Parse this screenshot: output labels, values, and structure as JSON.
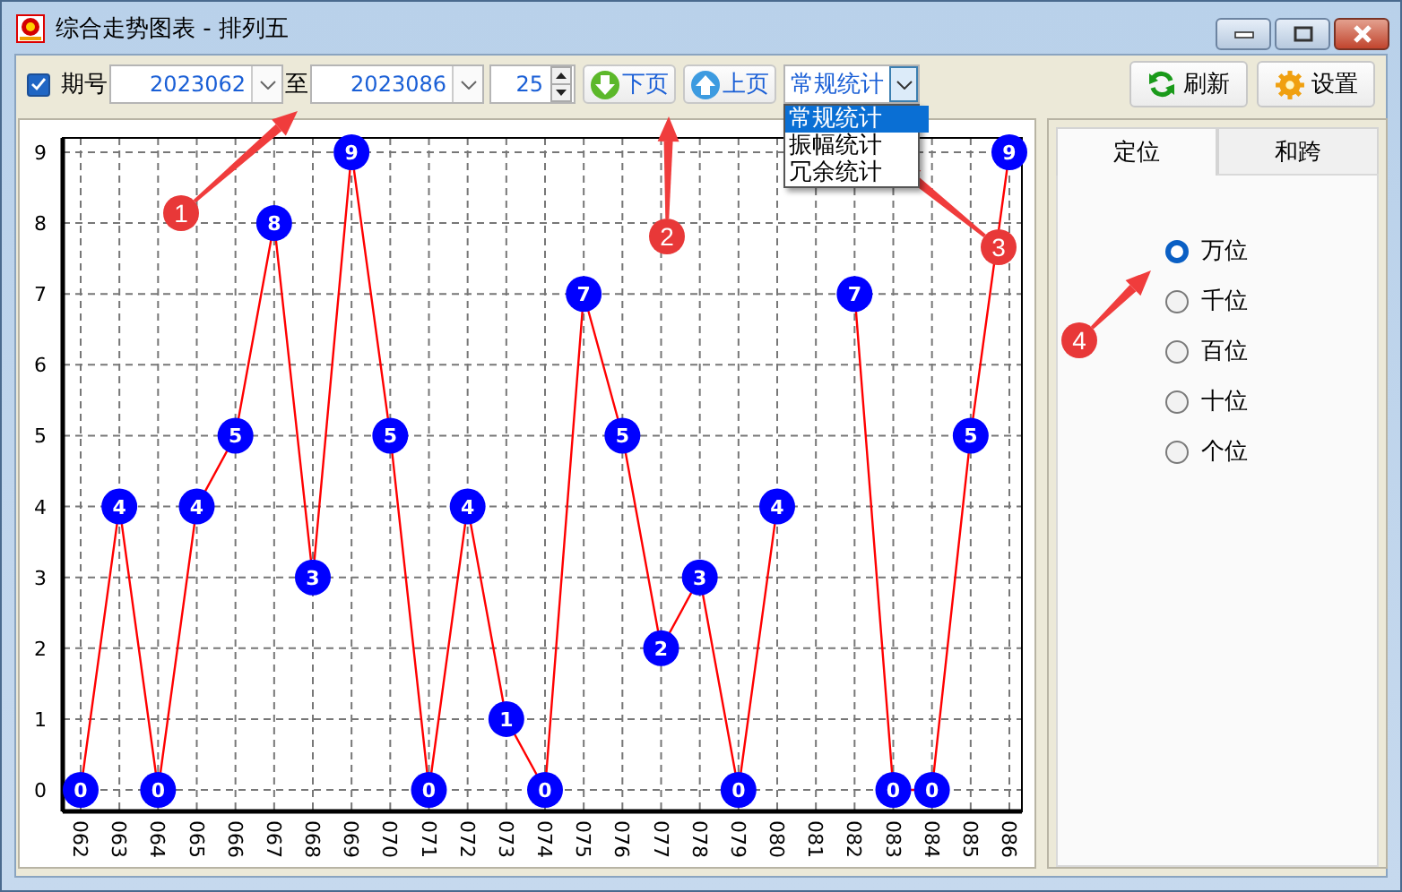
{
  "window": {
    "title": "综合走势图表 - 排列五"
  },
  "toolbar": {
    "period_checkbox": {
      "label": "期号",
      "checked": true
    },
    "from_issue": "2023062",
    "to_label": "至",
    "to_issue": "2023086",
    "count": "25",
    "next_page": "下页",
    "prev_page": "上页",
    "stat_select": {
      "value": "常规统计",
      "open": true,
      "options": [
        {
          "label": "常规统计",
          "selected": true
        },
        {
          "label": "振幅统计",
          "selected": false
        },
        {
          "label": "冗余统计",
          "selected": false
        }
      ]
    },
    "refresh": "刷新",
    "settings": "设置"
  },
  "chart": {
    "chart_data": {
      "type": "line",
      "categories": [
        "062",
        "063",
        "064",
        "065",
        "066",
        "067",
        "068",
        "069",
        "070",
        "071",
        "072",
        "073",
        "074",
        "075",
        "076",
        "077",
        "078",
        "079",
        "080",
        "081",
        "082",
        "083",
        "084",
        "085",
        "086"
      ],
      "series": [
        {
          "color": "#ff0000",
          "marker": "circle",
          "values": [
            0,
            4,
            0,
            4,
            5,
            8,
            3,
            9,
            5,
            0,
            4,
            1,
            0,
            7,
            5,
            2,
            3,
            0,
            4,
            null,
            7,
            0,
            0,
            5,
            9
          ]
        }
      ],
      "ylim": [
        0,
        9
      ],
      "yticks": [
        0,
        1,
        2,
        3,
        4,
        5,
        6,
        7,
        8,
        9
      ],
      "grid": true,
      "data_labels": true
    }
  },
  "side_panel": {
    "tabs": [
      {
        "label": "定位",
        "selected": true
      },
      {
        "label": "和跨",
        "selected": false
      }
    ],
    "positions": [
      {
        "label": "万位",
        "selected": true
      },
      {
        "label": "千位",
        "selected": false
      },
      {
        "label": "百位",
        "selected": false
      },
      {
        "label": "十位",
        "selected": false
      },
      {
        "label": "个位",
        "selected": false
      }
    ]
  },
  "callouts": [
    {
      "label": "1"
    },
    {
      "label": "2"
    },
    {
      "label": "3"
    },
    {
      "label": "4"
    }
  ]
}
